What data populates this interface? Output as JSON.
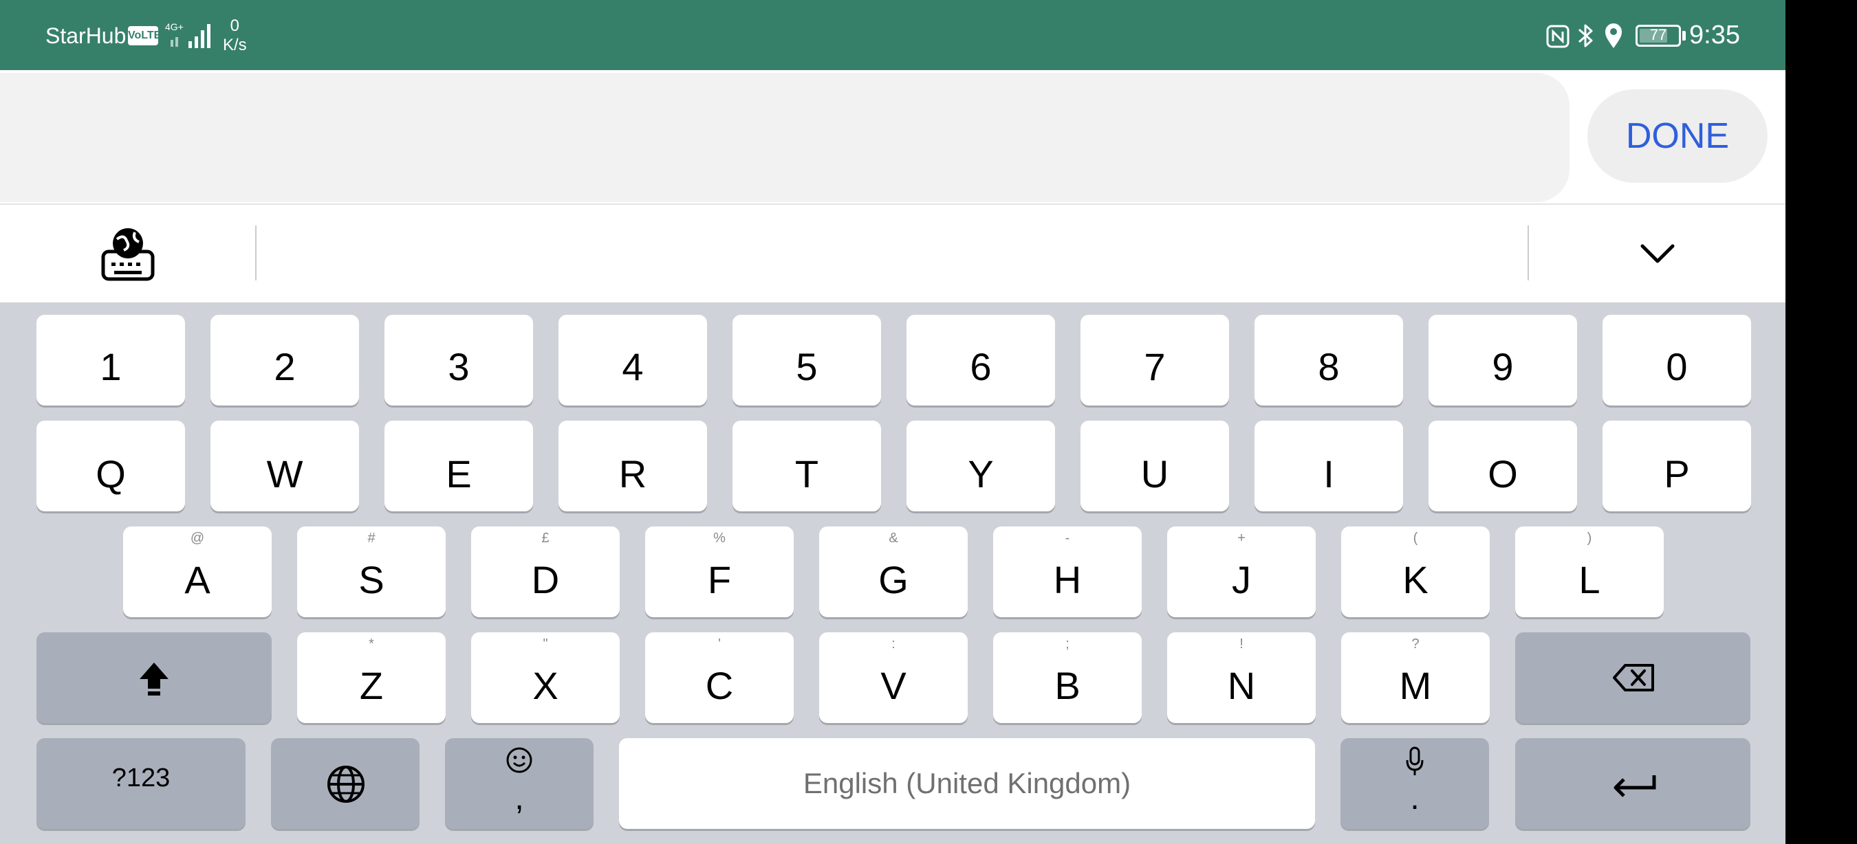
{
  "status_bar": {
    "carrier": "StarHub",
    "volte": "VoLTE",
    "network": "4G+",
    "speed_value": "0",
    "speed_unit": "K/s",
    "battery": "77",
    "time": "9:35"
  },
  "input": {
    "value": "",
    "done_label": "DONE"
  },
  "toolbar": {
    "language_icon": "keyboard-globe-icon",
    "collapse_icon": "chevron-down-icon"
  },
  "keyboard": {
    "number_row": [
      "1",
      "2",
      "3",
      "4",
      "5",
      "6",
      "7",
      "8",
      "9",
      "0"
    ],
    "row_q": [
      "Q",
      "W",
      "E",
      "R",
      "T",
      "Y",
      "U",
      "I",
      "O",
      "P"
    ],
    "row_a": [
      {
        "key": "A",
        "alt": "@"
      },
      {
        "key": "S",
        "alt": "#"
      },
      {
        "key": "D",
        "alt": "£"
      },
      {
        "key": "F",
        "alt": "%"
      },
      {
        "key": "G",
        "alt": "&"
      },
      {
        "key": "H",
        "alt": "-"
      },
      {
        "key": "J",
        "alt": "+"
      },
      {
        "key": "K",
        "alt": "("
      },
      {
        "key": "L",
        "alt": ")"
      }
    ],
    "row_z": [
      {
        "key": "Z",
        "alt": "*"
      },
      {
        "key": "X",
        "alt": "\""
      },
      {
        "key": "C",
        "alt": "'"
      },
      {
        "key": "V",
        "alt": ":"
      },
      {
        "key": "B",
        "alt": ";"
      },
      {
        "key": "N",
        "alt": "!"
      },
      {
        "key": "M",
        "alt": "?"
      }
    ],
    "symbols_label": "?123",
    "comma": ",",
    "period": ".",
    "space_label": "English (United Kingdom)"
  },
  "colors": {
    "status_bar": "#368069",
    "accent": "#2f5fdc",
    "keyboard_bg": "#cfd2d8",
    "function_key": "#a9afba"
  }
}
